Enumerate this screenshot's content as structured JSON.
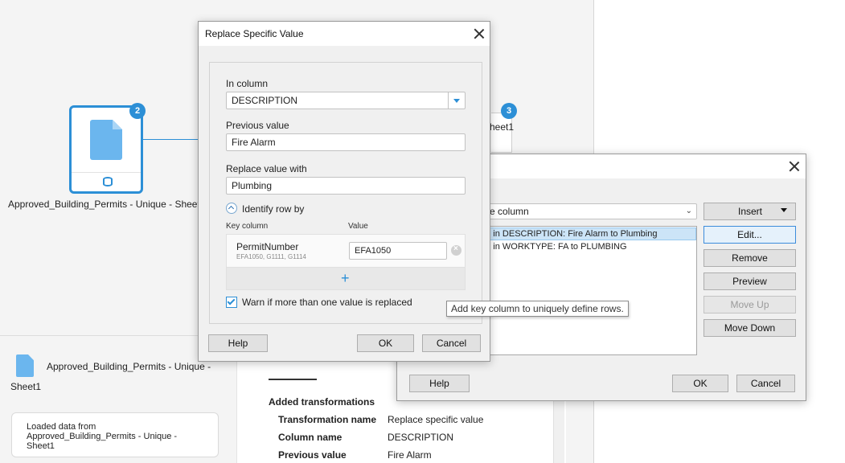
{
  "canvas": {
    "node2": {
      "badge": "2",
      "label": "Approved_Building_Permits - Unique - Sheet1"
    },
    "node3": {
      "badge": "3",
      "label_fragment": "heet1"
    }
  },
  "bottom": {
    "item_title_line1": "Approved_Building_Permits - Unique -",
    "item_title_line2": "Sheet1",
    "info_line1": "Loaded data from",
    "info_line2": "Approved_Building_Permits - Unique -",
    "info_line3": "Sheet1"
  },
  "details": {
    "heading": "Added transformations",
    "rows": [
      {
        "label": "Transformation name",
        "value": "Replace specific value"
      },
      {
        "label": "Column name",
        "value": "DESCRIPTION"
      },
      {
        "label": "Previous value",
        "value": "Fire Alarm"
      }
    ]
  },
  "back_dialog": {
    "combo_fragment": "e column",
    "list_items": [
      "ue in DESCRIPTION: Fire Alarm to Plumbing",
      "ue in WORKTYPE: FA to PLUMBING"
    ],
    "buttons": {
      "insert": "Insert",
      "edit": "Edit...",
      "remove": "Remove",
      "preview": "Preview",
      "move_up": "Move Up",
      "move_down": "Move Down",
      "help": "Help",
      "ok": "OK",
      "cancel": "Cancel"
    }
  },
  "dialog": {
    "title": "Replace Specific Value",
    "in_column_label": "In column",
    "in_column_value": "DESCRIPTION",
    "previous_value_label": "Previous value",
    "previous_value": "Fire Alarm",
    "replace_with_label": "Replace value with",
    "replace_with": "Plumbing",
    "identify_label": "Identify row by",
    "key_column_header": "Key column",
    "value_header": "Value",
    "key_name": "PermitNumber",
    "key_samples": "EFA1050, G1111, G1114",
    "key_value": "EFA1050",
    "warn_label": "Warn if more than one value is replaced",
    "warn_checked": true,
    "buttons": {
      "help": "Help",
      "ok": "OK",
      "cancel": "Cancel"
    }
  },
  "tooltip": "Add key column to uniquely define rows.",
  "colors": {
    "accent": "#2c8fd6",
    "file_icon": "#6bb6ee"
  }
}
